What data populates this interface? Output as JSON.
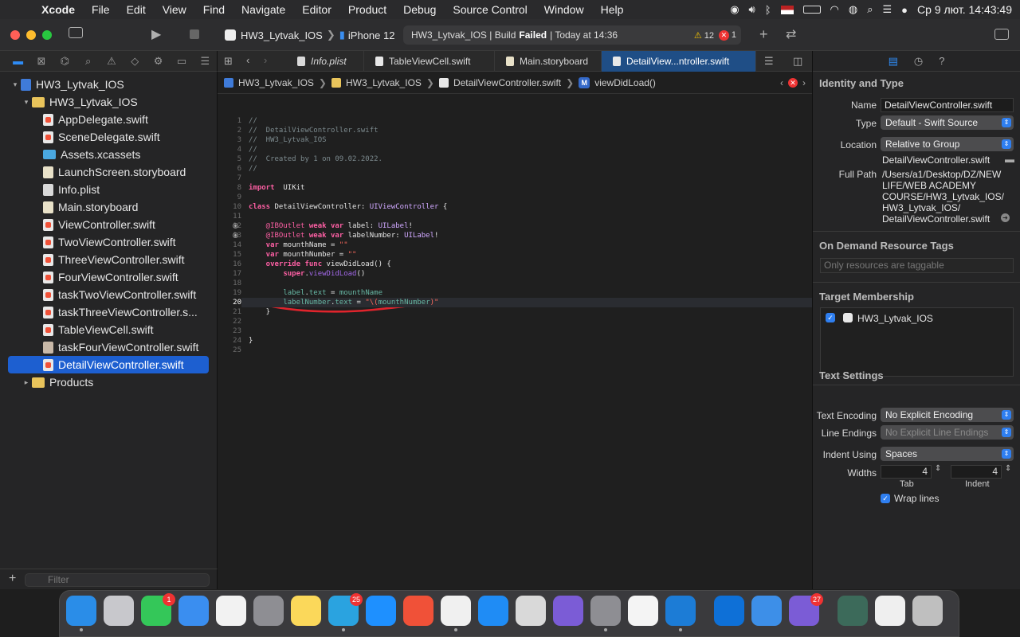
{
  "menubar": {
    "items": [
      "Xcode",
      "File",
      "Edit",
      "View",
      "Find",
      "Navigate",
      "Editor",
      "Product",
      "Debug",
      "Source Control",
      "Window",
      "Help"
    ],
    "clock": "Ср 9 лют.  14:43:49"
  },
  "toolbar": {
    "scheme_project": "HW3_Lytvak_IOS",
    "scheme_device": "iPhone 12",
    "activity_prefix": "HW3_Lytvak_IOS | Build",
    "activity_status": "Failed",
    "activity_suffix": "| Today at 14:36",
    "warning_count": "12",
    "error_count": "1"
  },
  "navigator": {
    "items": [
      {
        "label": "HW3_Lytvak_IOS",
        "type": "proj",
        "disc": "▾",
        "indent": 0
      },
      {
        "label": "HW3_Lytvak_IOS",
        "type": "folder",
        "disc": "▾",
        "indent": 1
      },
      {
        "label": "AppDelegate.swift",
        "type": "swift",
        "disc": "",
        "indent": 2
      },
      {
        "label": "SceneDelegate.swift",
        "type": "swift",
        "disc": "",
        "indent": 2
      },
      {
        "label": "Assets.xcassets",
        "type": "assets",
        "disc": "",
        "indent": 2
      },
      {
        "label": "LaunchScreen.storyboard",
        "type": "storyboard",
        "disc": "",
        "indent": 2
      },
      {
        "label": "Info.plist",
        "type": "plist",
        "disc": "",
        "indent": 2
      },
      {
        "label": "Main.storyboard",
        "type": "storyboard",
        "disc": "",
        "indent": 2
      },
      {
        "label": "ViewController.swift",
        "type": "swift",
        "disc": "",
        "indent": 2
      },
      {
        "label": "TwoViewController.swift",
        "type": "swift",
        "disc": "",
        "indent": 2
      },
      {
        "label": "ThreeViewController.swift",
        "type": "swift",
        "disc": "",
        "indent": 2
      },
      {
        "label": "FourViewController.swift",
        "type": "swift",
        "disc": "",
        "indent": 2
      },
      {
        "label": "taskTwoViewController.swift",
        "type": "swift",
        "disc": "",
        "indent": 2
      },
      {
        "label": "taskThreeViewController.s...",
        "type": "swift",
        "disc": "",
        "indent": 2
      },
      {
        "label": "TableViewCell.swift",
        "type": "swift",
        "disc": "",
        "indent": 2
      },
      {
        "label": "taskFourViewController.swift",
        "type": "swiftb",
        "disc": "",
        "indent": 2
      },
      {
        "label": "DetailViewController.swift",
        "type": "swift",
        "disc": "",
        "indent": 2,
        "selected": true
      },
      {
        "label": "Products",
        "type": "folder",
        "disc": "▸",
        "indent": 1
      }
    ],
    "filter_placeholder": "Filter"
  },
  "tabs": [
    {
      "label": "Info.plist",
      "italic": true,
      "color": "#d9d9d9"
    },
    {
      "label": "TableViewCell.swift",
      "italic": false,
      "color": "#e8e8e8"
    },
    {
      "label": "Main.storyboard",
      "italic": false,
      "color": "#e8e1c8"
    },
    {
      "label": "DetailView...ntroller.swift",
      "italic": false,
      "color": "#e8e8e8",
      "active": true
    }
  ],
  "jumpbar": {
    "project": "HW3_Lytvak_IOS",
    "folder": "HW3_Lytvak_IOS",
    "file": "DetailViewController.swift",
    "symbol": "viewDidLoad()"
  },
  "editor": {
    "current_line": 20,
    "lines": [
      [
        [
          "cm",
          "//"
        ]
      ],
      [
        [
          "cm",
          "//  DetailViewController.swift"
        ]
      ],
      [
        [
          "cm",
          "//  HW3_Lytvak_IOS"
        ]
      ],
      [
        [
          "cm",
          "//"
        ]
      ],
      [
        [
          "cm",
          "//  Created by 1 on 09.02.2022."
        ]
      ],
      [
        [
          "cm",
          "//"
        ]
      ],
      [],
      [
        [
          "kw",
          "import"
        ],
        [
          "",
          "  UIKit"
        ]
      ],
      [],
      [
        [
          "kw",
          "class"
        ],
        [
          "",
          " DetailViewController: "
        ],
        [
          "ty",
          "UIViewController"
        ],
        [
          "",
          " {"
        ]
      ],
      [],
      [
        [
          "",
          ""
        ],
        [
          "at",
          "    @IBOutlet"
        ],
        [
          "",
          " "
        ],
        [
          "kw",
          "weak var"
        ],
        [
          "",
          " label: "
        ],
        [
          "ty",
          "UILabel"
        ],
        [
          "",
          "!"
        ]
      ],
      [
        [
          "at",
          "    @IBOutlet"
        ],
        [
          "",
          " "
        ],
        [
          "kw",
          "weak var"
        ],
        [
          "",
          " labelNumber: "
        ],
        [
          "ty",
          "UILabel"
        ],
        [
          "",
          "!"
        ]
      ],
      [
        [
          "kw",
          "    var"
        ],
        [
          "",
          " mounthName = "
        ],
        [
          "st",
          "\"\""
        ]
      ],
      [
        [
          "kw",
          "    var"
        ],
        [
          "",
          " mounthNumber = "
        ],
        [
          "st",
          "\"\""
        ]
      ],
      [
        [
          "kw",
          "    override func"
        ],
        [
          "",
          " viewDidLoad() {"
        ]
      ],
      [
        [
          "kw",
          "        super"
        ],
        [
          "",
          "."
        ],
        [
          "mt",
          "viewDidLoad"
        ],
        [
          "",
          "()"
        ]
      ],
      [],
      [
        [
          "id",
          "        label"
        ],
        [
          "",
          "."
        ],
        [
          "id",
          "text"
        ],
        [
          "",
          " = "
        ],
        [
          "id",
          "mounthName"
        ]
      ],
      [
        [
          "id",
          "        labelNumber"
        ],
        [
          "",
          "."
        ],
        [
          "id",
          "text"
        ],
        [
          "",
          " = "
        ],
        [
          "st",
          "\"\\("
        ],
        [
          "id",
          "mounthNumber"
        ],
        [
          "st",
          ")\""
        ]
      ],
      [
        [
          "",
          "    }"
        ]
      ],
      [],
      [],
      [
        [
          "",
          "}"
        ]
      ],
      []
    ],
    "breakpoint_lines": [
      12,
      13
    ]
  },
  "inspector": {
    "identity_title": "Identity and Type",
    "name_label": "Name",
    "name_value": "DetailViewController.swift",
    "type_label": "Type",
    "type_value": "Default - Swift Source",
    "location_label": "Location",
    "location_value": "Relative to Group",
    "location_file": "DetailViewController.swift",
    "fullpath_label": "Full Path",
    "fullpath_lines": [
      "/Users/a1/Desktop/DZ/NEW",
      "LIFE/WEB ACADEMY",
      "COURSE/HW3_Lytvak_IOS/",
      "HW3_Lytvak_IOS/",
      "DetailViewController.swift"
    ],
    "ondemand_title": "On Demand Resource Tags",
    "ondemand_placeholder": "Only resources are taggable",
    "target_title": "Target Membership",
    "target_item": "HW3_Lytvak_IOS",
    "text_title": "Text Settings",
    "encoding_label": "Text Encoding",
    "encoding_value": "No Explicit Encoding",
    "endings_label": "Line Endings",
    "endings_value": "No Explicit Line Endings",
    "indent_label": "Indent Using",
    "indent_value": "Spaces",
    "widths_label": "Widths",
    "tab_value": "4",
    "indent_width_value": "4",
    "tab_caption": "Tab",
    "indent_caption": "Indent",
    "wrap_label": "Wrap lines"
  },
  "dock": {
    "apps": [
      {
        "name": "finder",
        "color": "#2a8de8",
        "running": true
      },
      {
        "name": "launchpad",
        "color": "#c8c8cc"
      },
      {
        "name": "facetime",
        "color": "#34c759",
        "badge": "1"
      },
      {
        "name": "mail",
        "color": "#3a8ef0"
      },
      {
        "name": "photos",
        "color": "#f2f2f2"
      },
      {
        "name": "calculator",
        "color": "#8e8e93"
      },
      {
        "name": "notes",
        "color": "#fbd85a"
      },
      {
        "name": "telegram",
        "color": "#2aa3e0",
        "badge": "25",
        "running": true
      },
      {
        "name": "safari",
        "color": "#1e90ff"
      },
      {
        "name": "swift-playgrounds",
        "color": "#f05138"
      },
      {
        "name": "chrome",
        "color": "#f0f0f0",
        "running": true
      },
      {
        "name": "app-store",
        "color": "#1f8cf5"
      },
      {
        "name": "automator",
        "color": "#d9d9d9"
      },
      {
        "name": "viber",
        "color": "#7b5cd6"
      },
      {
        "name": "system-preferences",
        "color": "#8e8e93",
        "running": true
      },
      {
        "name": "slack",
        "color": "#f4f4f4"
      },
      {
        "name": "xcode",
        "color": "#1c7cd6",
        "running": true
      },
      {
        "name": "teamviewer",
        "color": "#0e70d7"
      },
      {
        "name": "xcode-beta",
        "color": "#3d8fe8"
      },
      {
        "name": "viber-2",
        "color": "#7b5cd6",
        "badge": "27"
      },
      {
        "name": "screenshot",
        "color": "#3c6a5a"
      },
      {
        "name": "preview",
        "color": "#efefef"
      },
      {
        "name": "trash",
        "color": "#bfbfbf"
      }
    ]
  }
}
